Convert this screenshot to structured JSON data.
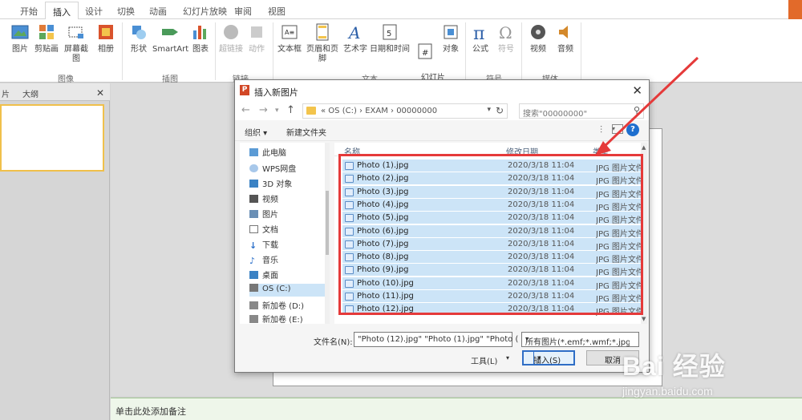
{
  "ribbon": {
    "tabs": [
      "开始",
      "插入",
      "设计",
      "切换",
      "动画",
      "幻灯片放映",
      "审阅",
      "视图"
    ],
    "buttons": [
      {
        "label": "图片",
        "icon": "picture-icon"
      },
      {
        "label": "剪贴画",
        "icon": "clipart-icon"
      },
      {
        "label": "屏幕截图",
        "icon": "screenshot-icon"
      },
      {
        "label": "相册",
        "icon": "album-icon"
      },
      {
        "label": "形状",
        "icon": "shapes-icon"
      },
      {
        "label": "SmartArt",
        "icon": "smartart-icon"
      },
      {
        "label": "图表",
        "icon": "chart-icon"
      },
      {
        "label": "超链接",
        "icon": "hyperlink-icon"
      },
      {
        "label": "动作",
        "icon": "action-icon"
      },
      {
        "label": "文本框",
        "icon": "textbox-icon"
      },
      {
        "label": "页眉和页脚",
        "icon": "header-footer-icon"
      },
      {
        "label": "艺术字",
        "icon": "wordart-icon"
      },
      {
        "label": "日期和时间",
        "icon": "datetime-icon"
      },
      {
        "label": "幻灯片\n编号",
        "icon": "slide-number-icon"
      },
      {
        "label": "对象",
        "icon": "object-icon"
      },
      {
        "label": "公式",
        "icon": "equation-icon"
      },
      {
        "label": "符号",
        "icon": "symbol-icon"
      },
      {
        "label": "视频",
        "icon": "video-icon"
      },
      {
        "label": "音频",
        "icon": "audio-icon"
      }
    ],
    "groups": [
      "图像",
      "插图",
      "链接",
      "文本",
      "符号",
      "媒体"
    ]
  },
  "left_pane": {
    "tab1": "片",
    "tab2": "大纲"
  },
  "notes": "单击此处添加备注",
  "dialog": {
    "title": "插入新图片",
    "address": "«  OS (C:)  ›  EXAM  ›  00000000",
    "search_placeholder": "搜索\"00000000\"",
    "organize": "组织 ▾",
    "new_folder": "新建文件夹",
    "help": "?",
    "tree": [
      {
        "label": "此电脑",
        "icon": "computer-icon"
      },
      {
        "label": "WPS网盘",
        "icon": "cloud-icon"
      },
      {
        "label": "3D 对象",
        "icon": "3d-objects-icon"
      },
      {
        "label": "视频",
        "icon": "video-folder-icon"
      },
      {
        "label": "图片",
        "icon": "pictures-folder-icon"
      },
      {
        "label": "文档",
        "icon": "documents-folder-icon"
      },
      {
        "label": "下载",
        "icon": "download-icon"
      },
      {
        "label": "音乐",
        "icon": "music-icon"
      },
      {
        "label": "桌面",
        "icon": "desktop-icon"
      },
      {
        "label": "OS (C:)",
        "icon": "drive-icon"
      },
      {
        "label": "新加卷 (D:)",
        "icon": "drive-icon"
      },
      {
        "label": "新加卷 (E:)",
        "icon": "drive-icon"
      }
    ],
    "columns": {
      "name": "名称",
      "date": "修改日期",
      "type": "类型"
    },
    "files": [
      {
        "name": "Photo (1).jpg",
        "date": "2020/3/18 11:04",
        "type": "JPG 图片文件"
      },
      {
        "name": "Photo (2).jpg",
        "date": "2020/3/18 11:04",
        "type": "JPG 图片文件"
      },
      {
        "name": "Photo (3).jpg",
        "date": "2020/3/18 11:04",
        "type": "JPG 图片文件"
      },
      {
        "name": "Photo (4).jpg",
        "date": "2020/3/18 11:04",
        "type": "JPG 图片文件"
      },
      {
        "name": "Photo (5).jpg",
        "date": "2020/3/18 11:04",
        "type": "JPG 图片文件"
      },
      {
        "name": "Photo (6).jpg",
        "date": "2020/3/18 11:04",
        "type": "JPG 图片文件"
      },
      {
        "name": "Photo (7).jpg",
        "date": "2020/3/18 11:04",
        "type": "JPG 图片文件"
      },
      {
        "name": "Photo (8).jpg",
        "date": "2020/3/18 11:04",
        "type": "JPG 图片文件"
      },
      {
        "name": "Photo (9).jpg",
        "date": "2020/3/18 11:04",
        "type": "JPG 图片文件"
      },
      {
        "name": "Photo (10).jpg",
        "date": "2020/3/18 11:04",
        "type": "JPG 图片文件"
      },
      {
        "name": "Photo (11).jpg",
        "date": "2020/3/18 11:04",
        "type": "JPG 图片文件"
      },
      {
        "name": "Photo (12).jpg",
        "date": "2020/3/18 11:04",
        "type": "JPG 图片文件"
      }
    ],
    "filename_label": "文件名(N):",
    "filename_value": "\"Photo (12).jpg\" \"Photo (1).jpg\" \"Photo (",
    "filetype_value": "所有图片(*.emf;*.wmf;*.jpg;*.jp",
    "tools": "工具(L)",
    "insert": "插入(S)",
    "cancel": "取消"
  },
  "watermark": {
    "logo": "Bai 经验",
    "url": "jingyan.baidu.com"
  },
  "colors": {
    "highlight": "#e53a3a",
    "selection": "#cce4f7",
    "accent": "#2f6ec6"
  }
}
